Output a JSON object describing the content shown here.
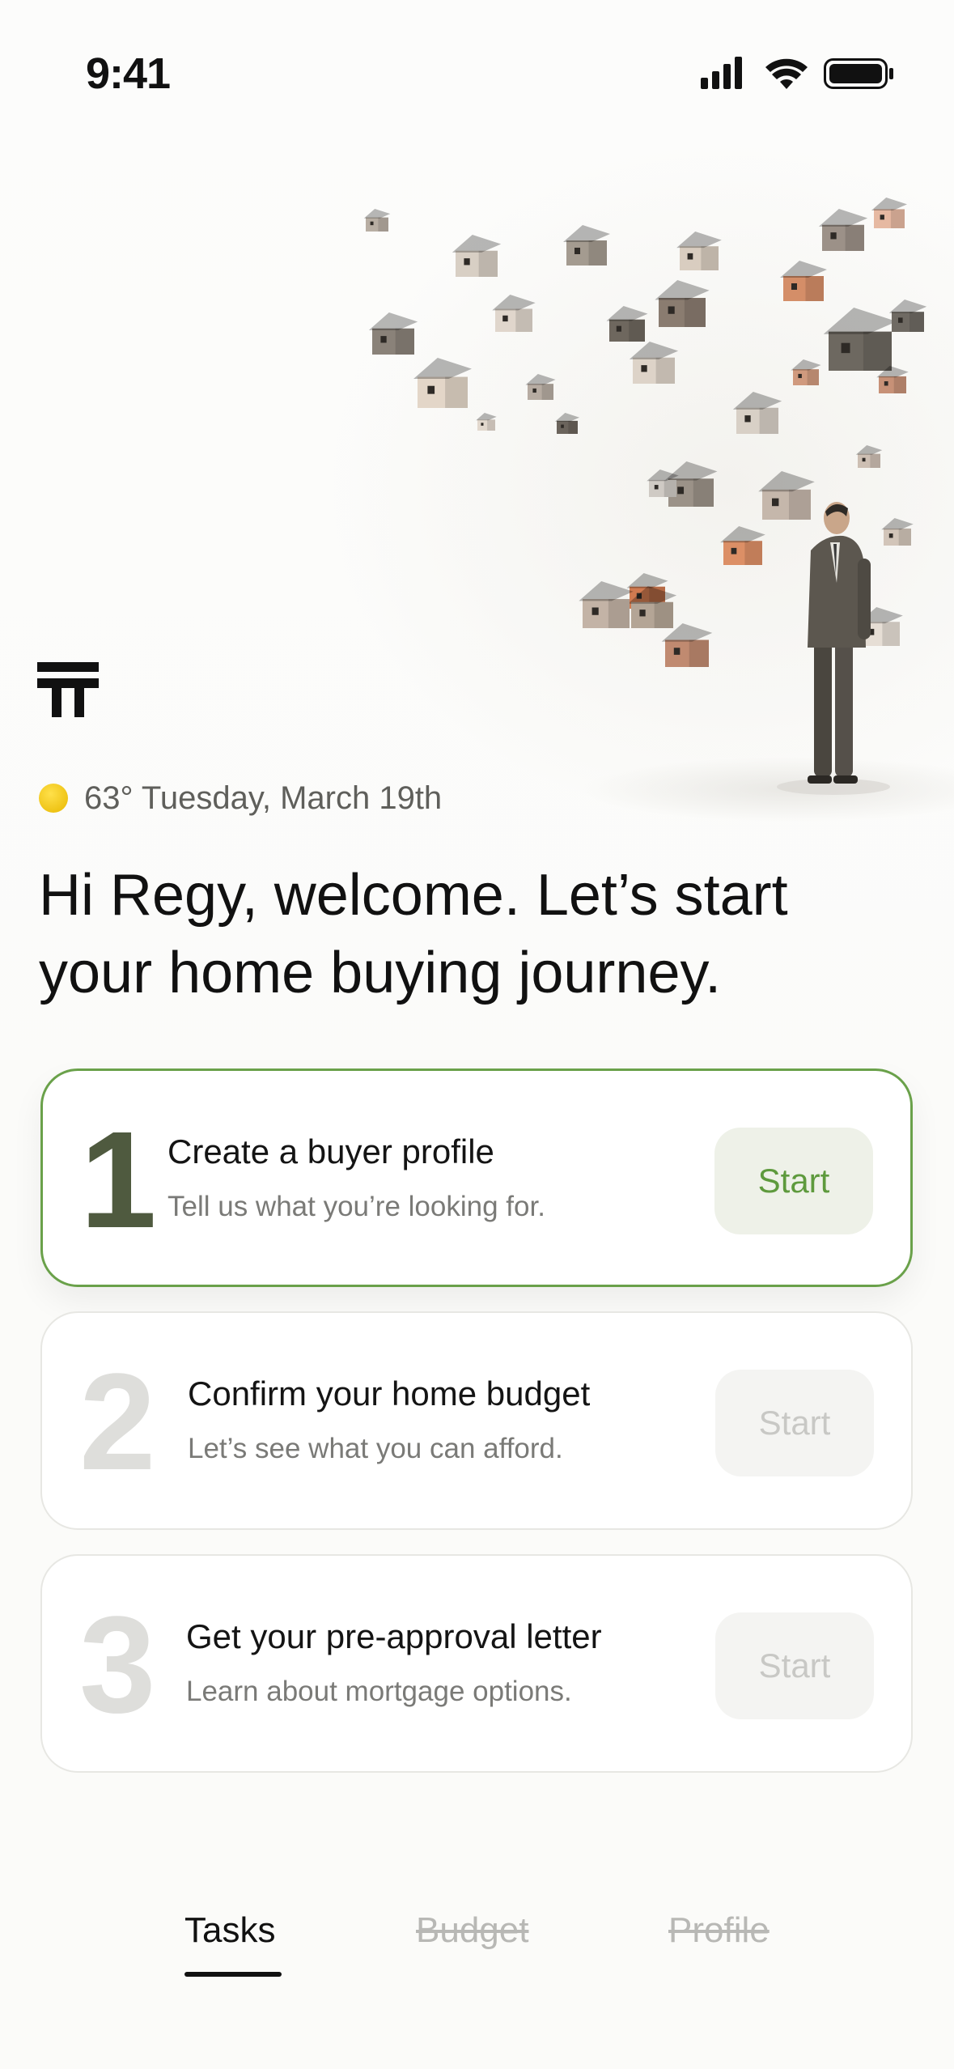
{
  "status_bar": {
    "time": "9:41"
  },
  "weather": {
    "temperature": "63°",
    "date": "Tuesday, March 19th",
    "icon": "sun-icon"
  },
  "greeting": "Hi Regy, welcome. Let’s start your home buying journey.",
  "tasks": [
    {
      "number": "1",
      "title": "Create a buyer profile",
      "subtitle": "Tell us what you’re looking for.",
      "button": "Start",
      "state": "active"
    },
    {
      "number": "2",
      "title": "Confirm your home budget",
      "subtitle": "Let’s see what you can afford.",
      "button": "Start",
      "state": "locked"
    },
    {
      "number": "3",
      "title": "Get your pre-approval letter",
      "subtitle": "Learn about mortgage options.",
      "button": "Start",
      "state": "locked"
    }
  ],
  "tabs": [
    {
      "label": "Tasks",
      "state": "selected"
    },
    {
      "label": "Budget",
      "state": "disabled"
    },
    {
      "label": "Profile",
      "state": "disabled"
    }
  ],
  "colors": {
    "accent": "#6aa14a",
    "active_number": "#4f5a3f",
    "muted": "#dededb"
  }
}
